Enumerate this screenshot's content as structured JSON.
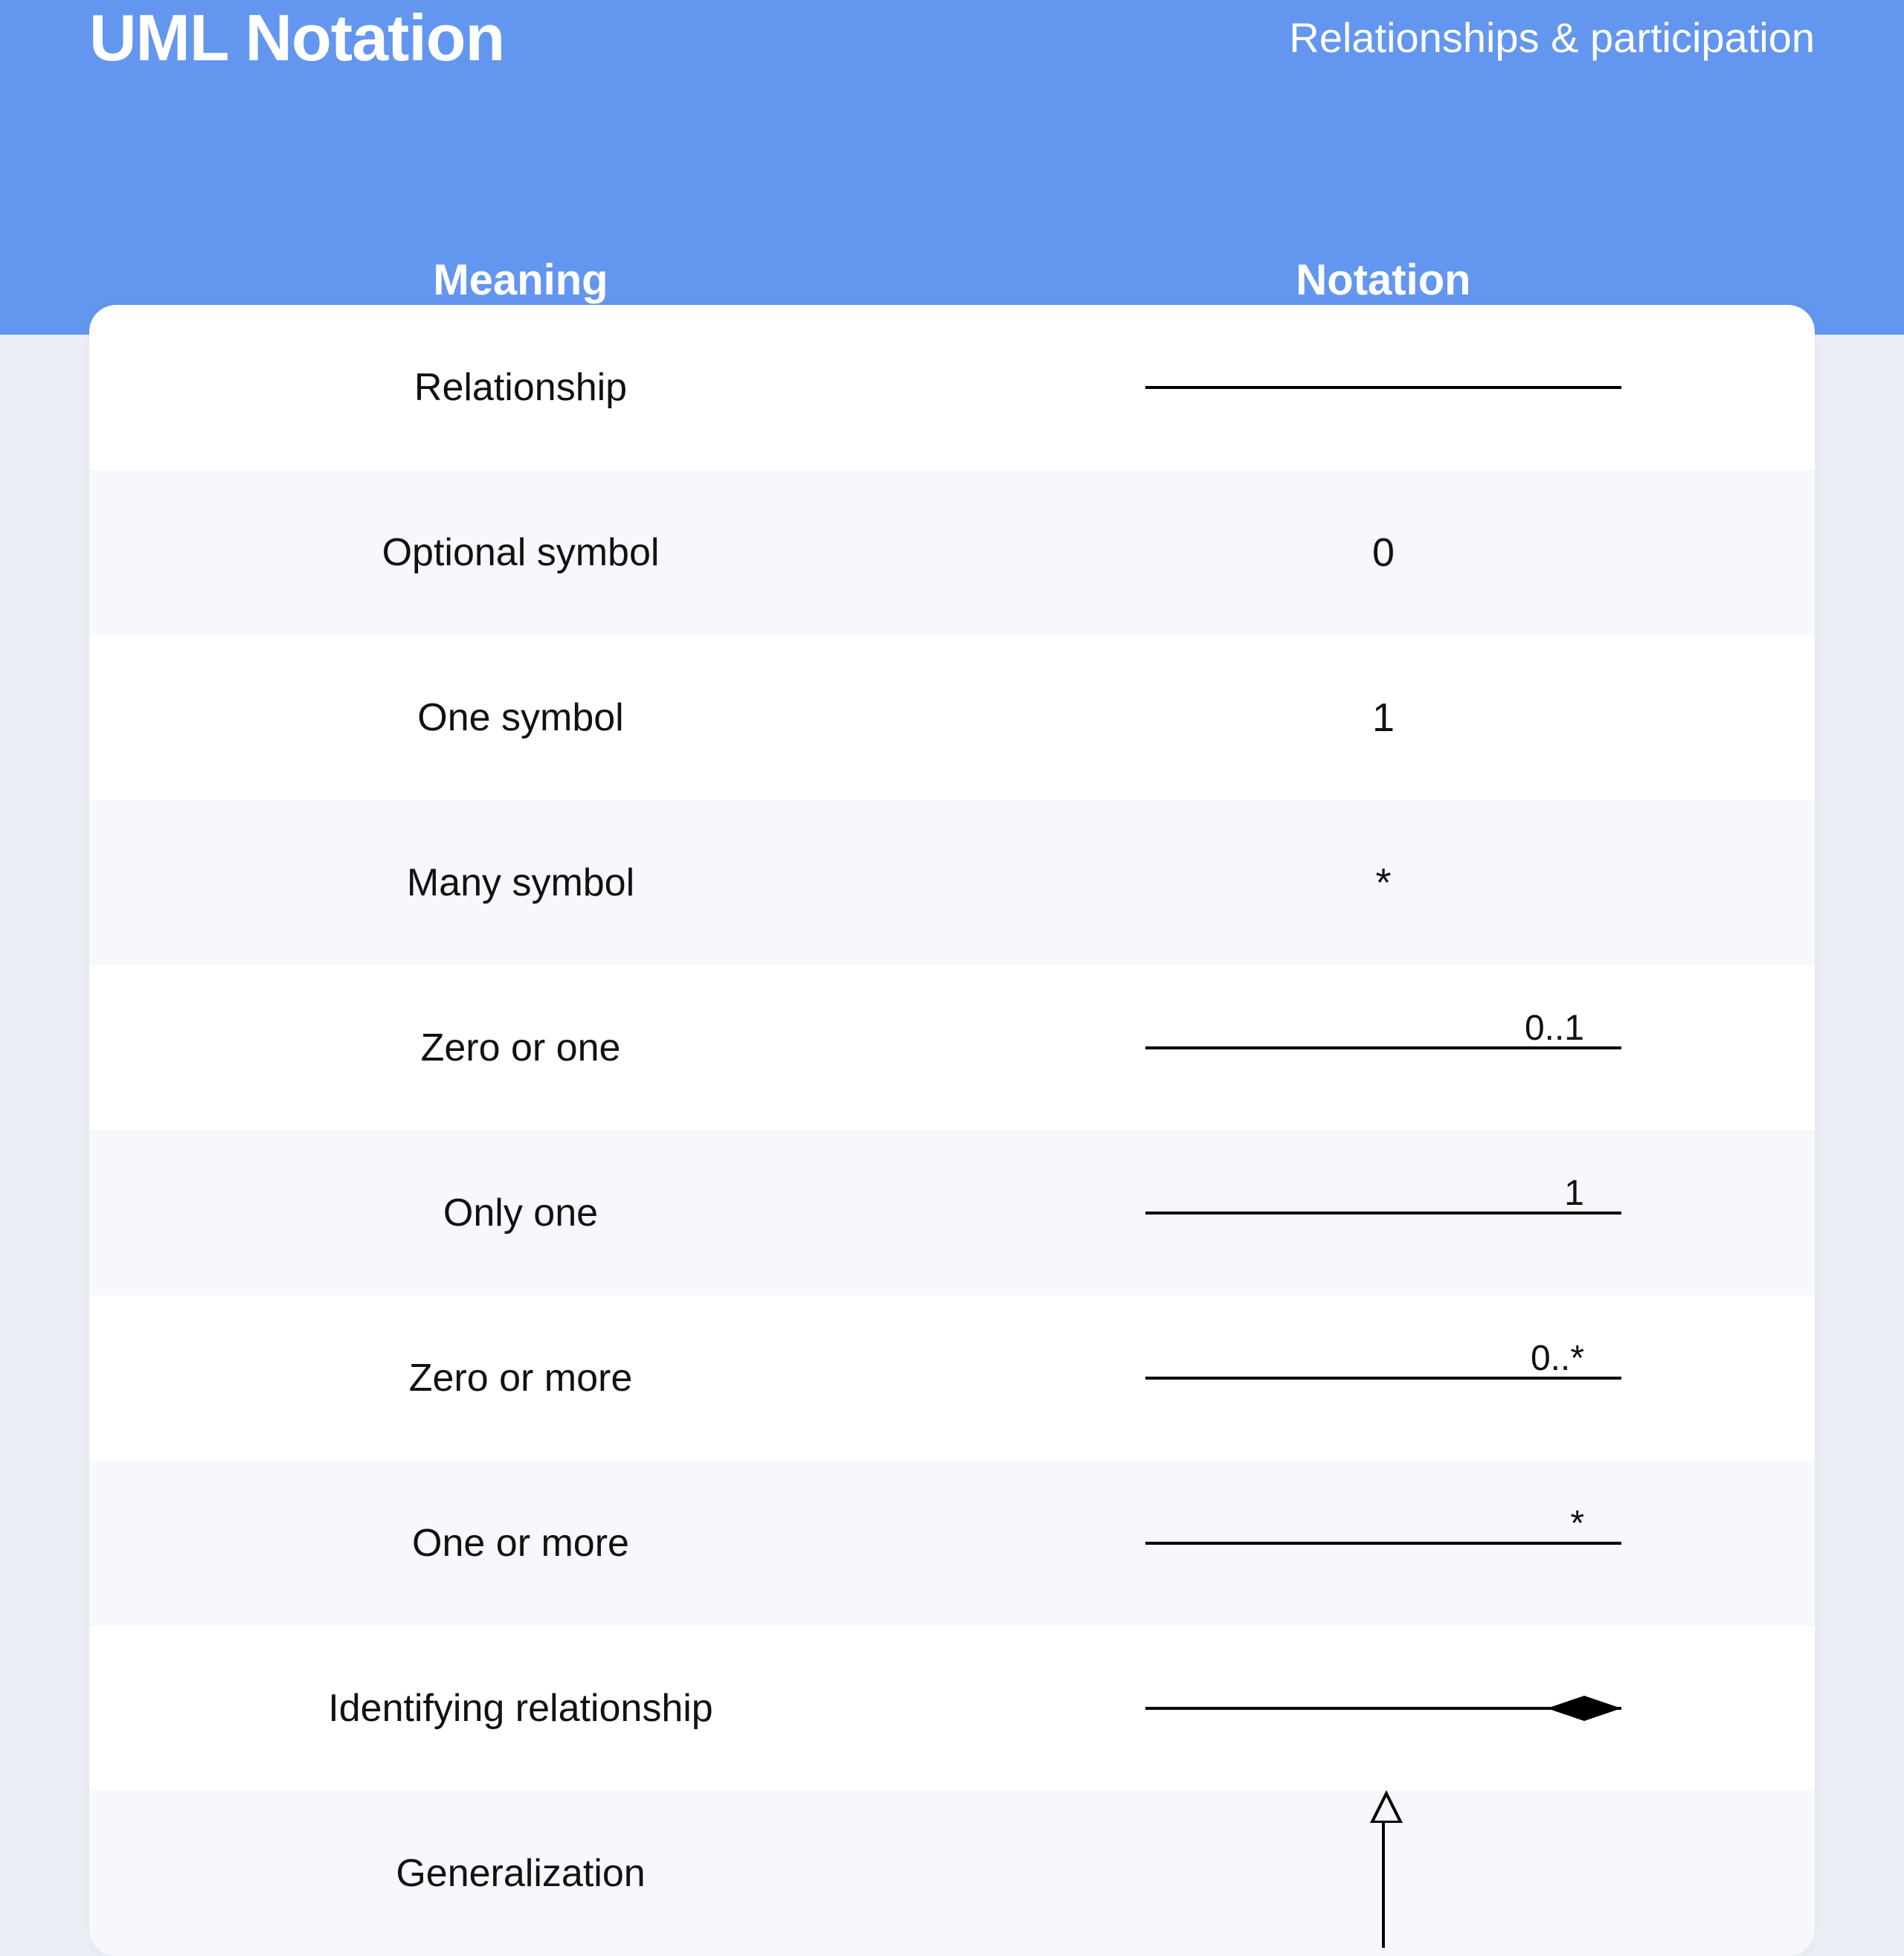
{
  "header": {
    "title": "UML Notation",
    "subtitle": "Relationships & participation",
    "col_meaning": "Meaning",
    "col_notation": "Notation"
  },
  "rows": [
    {
      "meaning": "Relationship"
    },
    {
      "meaning": "Optional symbol",
      "symbol": "0"
    },
    {
      "meaning": "One symbol",
      "symbol": "1"
    },
    {
      "meaning": "Many symbol",
      "symbol": "*"
    },
    {
      "meaning": "Zero or one",
      "label": "0..1"
    },
    {
      "meaning": "Only one",
      "label": "1"
    },
    {
      "meaning": "Zero or more",
      "label": "0..*"
    },
    {
      "meaning": "One or more",
      "label": "*"
    },
    {
      "meaning": "Identifying relationship"
    },
    {
      "meaning": "Generalization"
    }
  ]
}
